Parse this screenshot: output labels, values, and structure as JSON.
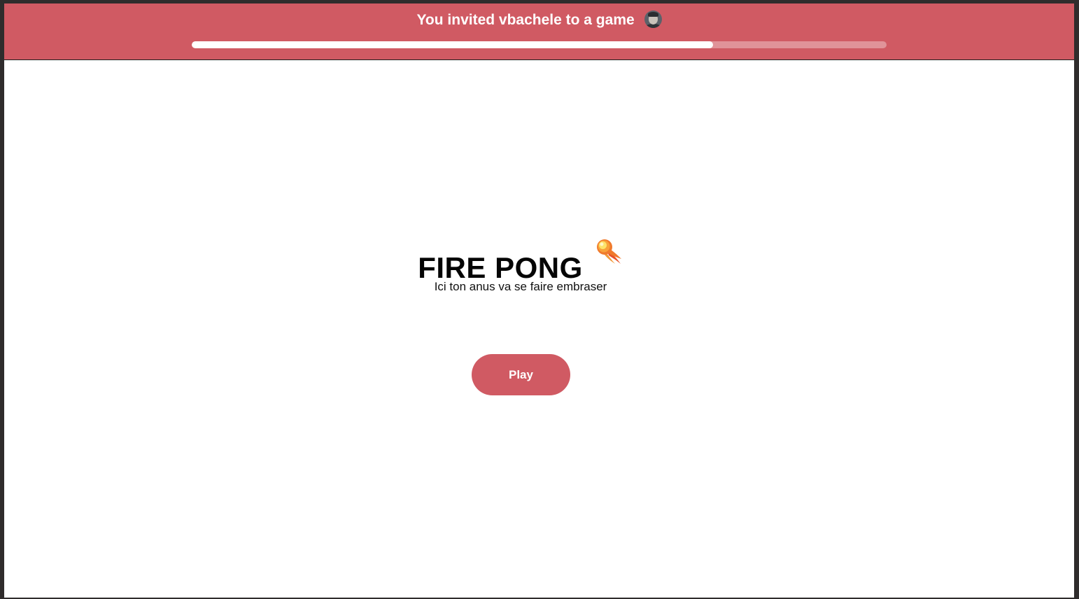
{
  "colors": {
    "accent": "#d05a63",
    "frame": "#2f2c2c",
    "background": "#ffffff"
  },
  "banner": {
    "message": "You invited vbachele to a game",
    "avatar_icon": "user-avatar",
    "progress_fraction": 0.75
  },
  "main": {
    "title": "FIRE PONG",
    "title_icon": "comet-fireball-icon",
    "subtitle": "Ici ton anus va se faire embraser",
    "play_label": "Play"
  }
}
